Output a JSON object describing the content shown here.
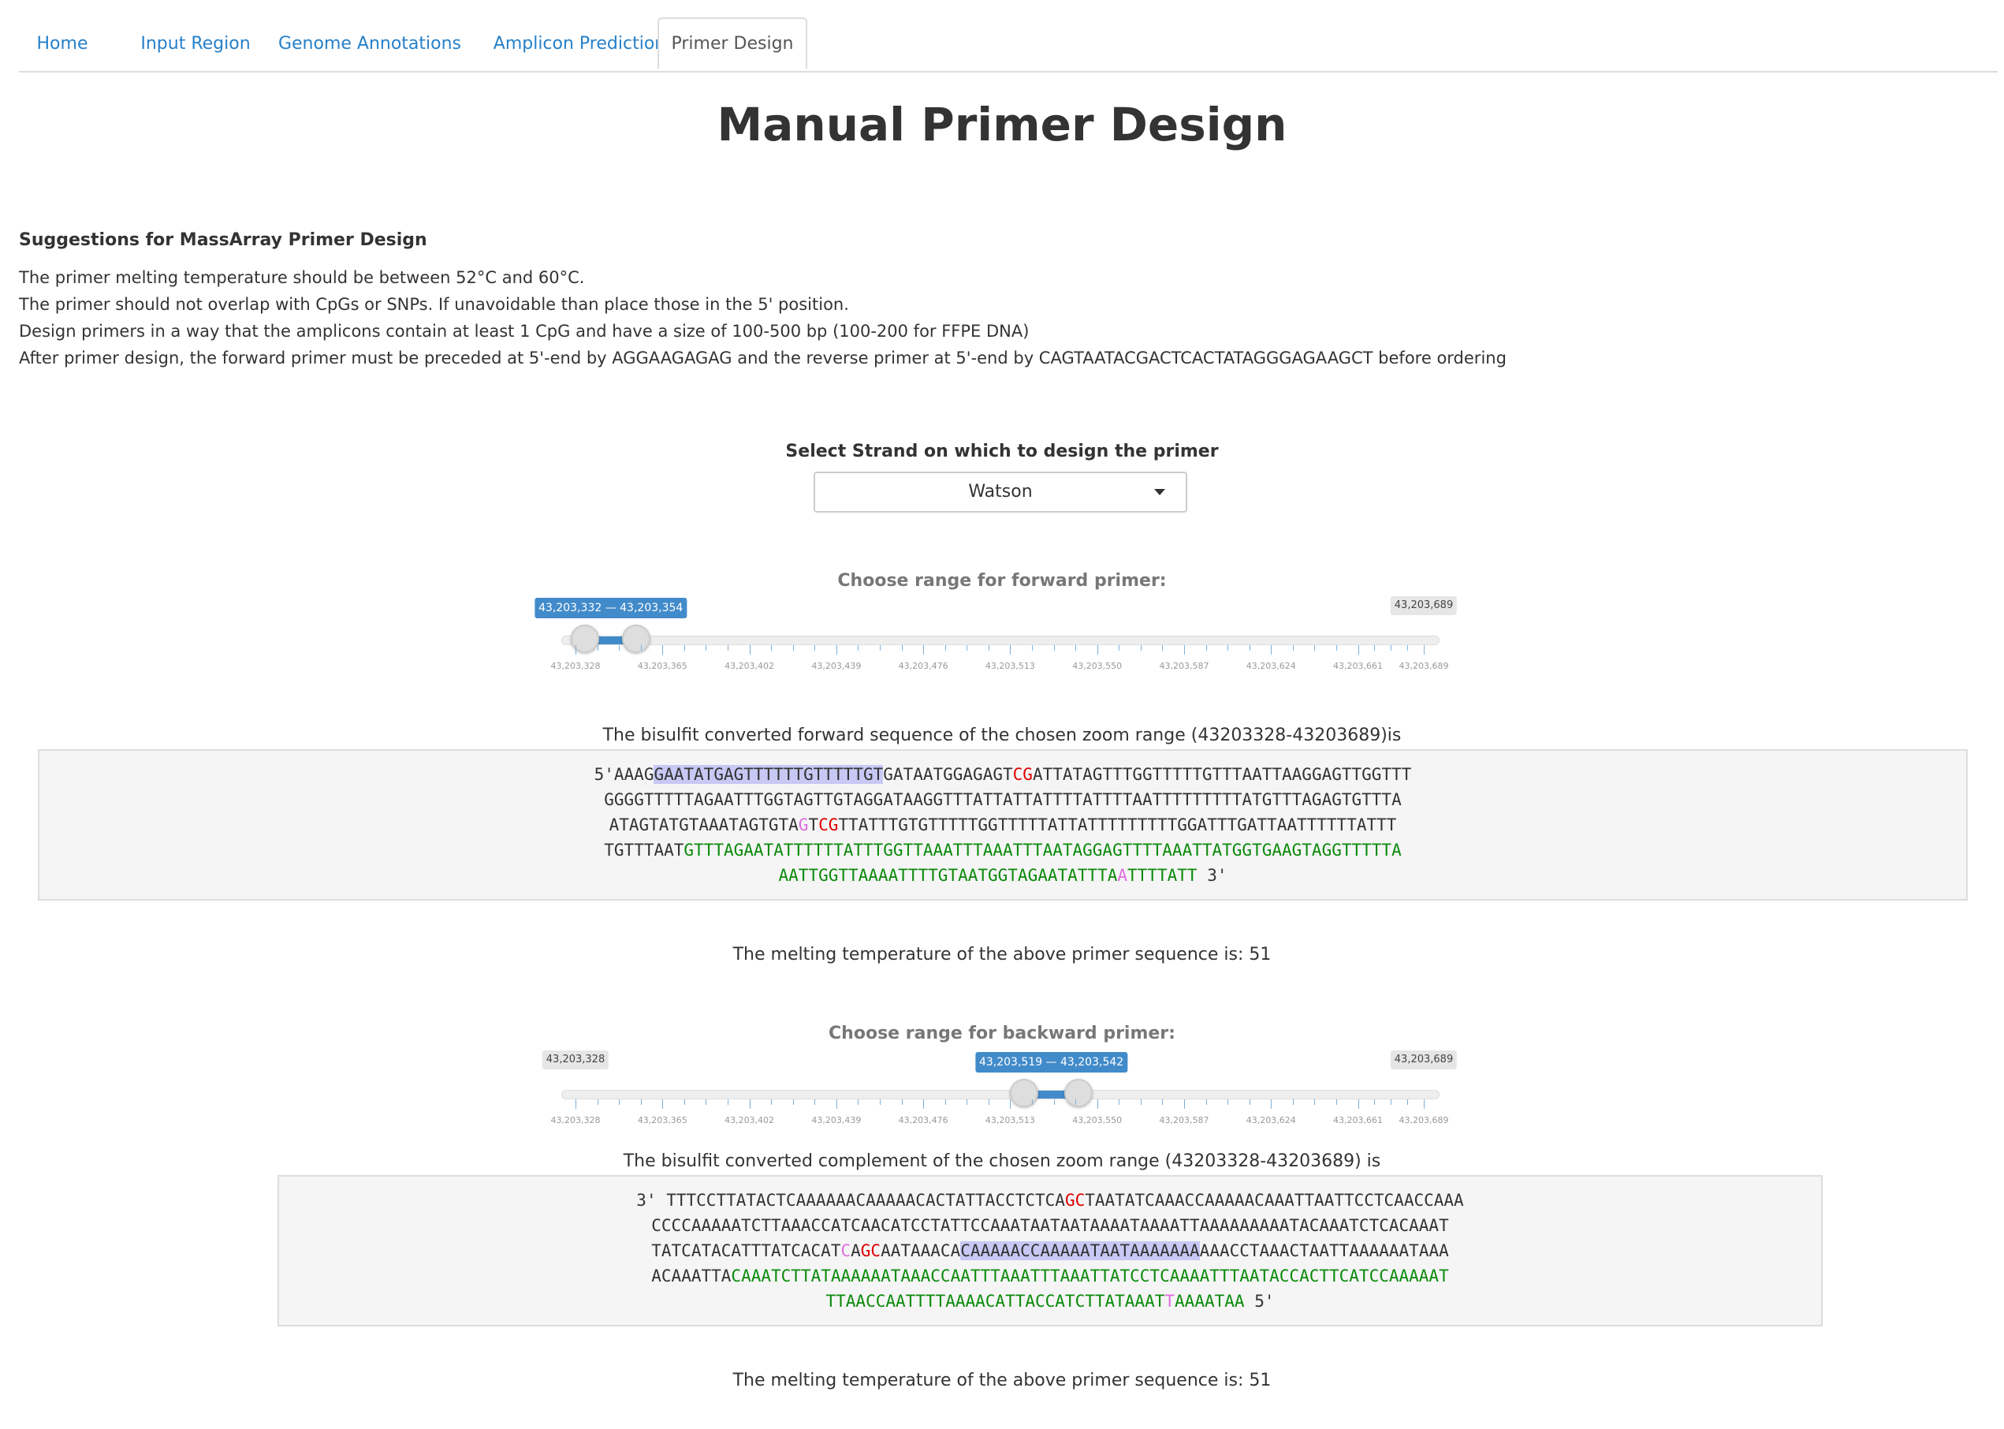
{
  "tabs": [
    {
      "label": "Home",
      "active": false
    },
    {
      "label": "Input Region",
      "active": false
    },
    {
      "label": "Genome Annotations",
      "active": false
    },
    {
      "label": "Amplicon Prediction",
      "active": false
    },
    {
      "label": "Primer Design",
      "active": true
    }
  ],
  "page_title": "Manual Primer Design",
  "suggestions": {
    "heading": "Suggestions for MassArray Primer Design",
    "lines": [
      "The primer melting temperature should be between 52°C and 60°C.",
      "The primer should not overlap with CpGs or SNPs. If unavoidable than place those in the 5' position.",
      "Design primers in a way that the amplicons contain at least 1 CpG and have a size of 100-500 bp (100-200 for FFPE DNA)",
      "After primer design, the forward primer must be preceded at 5'-end by AGGAAGAGAG and the reverse primer at 5'-end by CAGTAATACGACTCACTATAGGGAGAAGCT before ordering"
    ]
  },
  "strand": {
    "label": "Select Strand on which to design the primer",
    "selected": "Watson"
  },
  "forward": {
    "label": "Choose range for forward primer:",
    "range_text": "43,203,332 — 43,203,354",
    "max_label": "43,203,689",
    "min": 43203328,
    "max": 43203689,
    "from": 43203332,
    "to": 43203354,
    "caption": "The bisulfit converted forward sequence of the chosen zoom range (43203328-43203689)is",
    "seq_lines": [
      [
        [
          "",
          "5'AAAG"
        ],
        [
          "hl",
          "GAATATGAGTTTTTTGTTTTTGT"
        ],
        [
          "",
          "GATAATGGAGAGT"
        ],
        [
          "cg",
          "CG"
        ],
        [
          "",
          "ATTATAGTTTGGTTTTTGTTTAATTAAGGAGTTGGTTT"
        ]
      ],
      [
        [
          "",
          "GGGGTTTTTAGAATTTGGTAGTTGTAGGATAAGGTTTATTATTATTTTATTTTAATTTTTTTTTATGTTTAGAGTGTTTA"
        ]
      ],
      [
        [
          "",
          "ATAGTATGTAAATAGTGTA"
        ],
        [
          "pk",
          "G"
        ],
        [
          "",
          "T"
        ],
        [
          "cg",
          "CG"
        ],
        [
          "",
          "TTATTTGTGTTTTTGGTTTTTATTATTTTTTTTTGGATTTGATTAATTTTTTATTT"
        ]
      ],
      [
        [
          "",
          "TGTTTAAT"
        ],
        [
          "gr",
          "GTTTAGAATATTTTTTATTTGGTTAAATTTAAATTTAATAGGAGTTTTAAATTATGGTGAAGTAGGTTTTTA"
        ]
      ],
      [
        [
          "gr",
          "AATTGGTTAAAATTTTGTAATGGTAGAATATTTA"
        ],
        [
          "pk",
          "A"
        ],
        [
          "gr",
          "TTTTATT"
        ],
        [
          "",
          " 3'"
        ]
      ]
    ],
    "melting_text": "The melting temperature of the above primer sequence is: 51"
  },
  "backward": {
    "label": "Choose range for backward primer:",
    "range_text": "43,203,519 — 43,203,542",
    "min_label": "43,203,328",
    "max_label": "43,203,689",
    "min": 43203328,
    "max": 43203689,
    "from": 43203519,
    "to": 43203542,
    "caption": "The bisulfit converted complement of the chosen zoom range (43203328-43203689) is",
    "seq_lines": [
      [
        [
          "",
          "3' TTTCCTTATACTCAAAAAACAAAAACACTATTACCTCTCA"
        ],
        [
          "cg",
          "GC"
        ],
        [
          "",
          "TAATATCAAACCAAAAACAAATTAATTCCTCAACCAAA"
        ]
      ],
      [
        [
          "",
          "CCCCAAAAATCTTAAACCATCAACATCCTATTCCAAATAATAATAAAATAAAATTAAAAAAAAATACAAATCTCACAAAT"
        ]
      ],
      [
        [
          "",
          "TATCATACATTTATCACAT"
        ],
        [
          "pk",
          "C"
        ],
        [
          "",
          "A"
        ],
        [
          "cg",
          "GC"
        ],
        [
          "",
          "AATAAACA"
        ],
        [
          "hl",
          "CAAAAACCAAAAATAATAAAAAAA"
        ],
        [
          "",
          "AAACCTAAACTAATTAAAAAATAAA"
        ]
      ],
      [
        [
          "",
          "ACAAATTA"
        ],
        [
          "gr",
          "CAAATCTTATAAAAAATAAACCAATTTAAATTTAAATTATCCTCAAAATTTAATACCACTTCATCCAAAAAT"
        ]
      ],
      [
        [
          "gr",
          "TTAACCAATTTTAAAACATTACCATCTTATAAAT"
        ],
        [
          "pk",
          "T"
        ],
        [
          "gr",
          "AAAATAA"
        ],
        [
          "",
          " 5'"
        ]
      ]
    ],
    "melting_text": "The melting temperature of the above primer sequence is: 51"
  },
  "tick_labels": [
    "43,203,328",
    "43,203,365",
    "43,203,402",
    "43,203,439",
    "43,203,476",
    "43,203,513",
    "43,203,550",
    "43,203,587",
    "43,203,624",
    "43,203,661",
    "43,203,689"
  ],
  "colors": {
    "accent": "#428bca",
    "link": "#2780c8",
    "cpg": "#e00000",
    "snp": "#e06ee0",
    "amplicon": "#0b8a0b",
    "primer_highlight": "#c8c8f5"
  }
}
